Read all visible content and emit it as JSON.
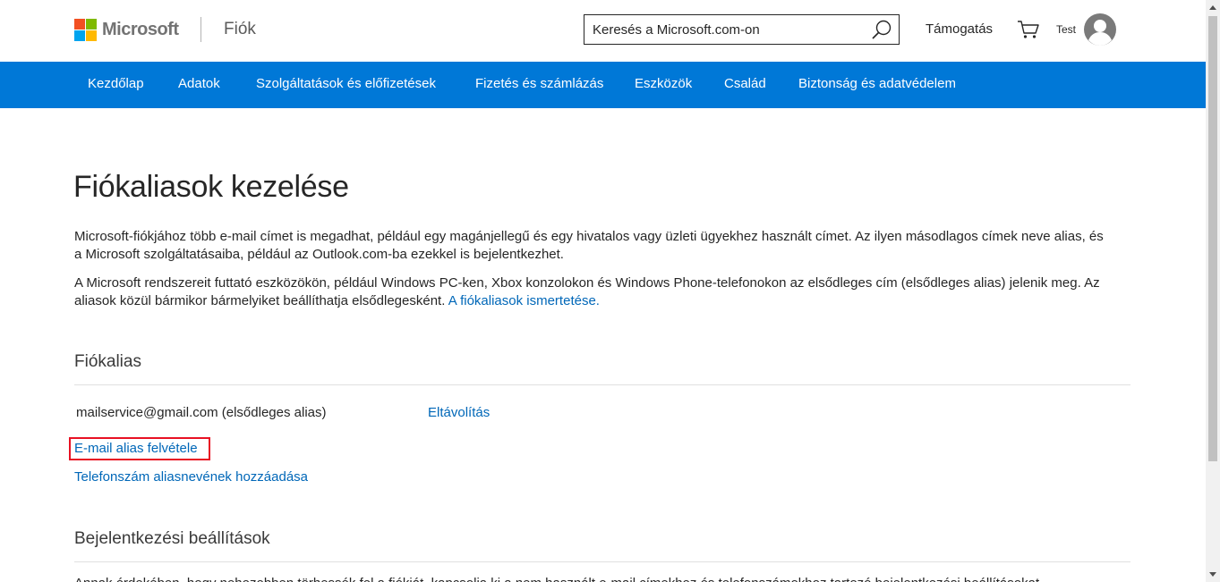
{
  "header": {
    "logo_text": "Microsoft",
    "section": "Fiók",
    "search_placeholder": "Keresés a Microsoft.com-on",
    "support_label": "Támogatás",
    "user_name": "Test"
  },
  "nav": {
    "items": [
      {
        "label": "Kezdőlap"
      },
      {
        "label": "Adatok"
      },
      {
        "label": "Szolgáltatások és előfizetések"
      },
      {
        "label": "Fizetés és számlázás"
      },
      {
        "label": "Eszközök"
      },
      {
        "label": "Család"
      },
      {
        "label": "Biztonság és adatvédelem"
      }
    ]
  },
  "main": {
    "title": "Fiókaliasok kezelése",
    "paragraph1": "Microsoft-fiókjához több e-mail címet is megadhat, például egy magánjellegű és egy hivatalos vagy üzleti ügyekhez használt címet. Az ilyen másodlagos címek neve alias, és a Microsoft szolgáltatásaiba, például az Outlook.com-ba ezekkel is bejelentkezhet.",
    "paragraph2": "A Microsoft rendszereit futtató eszközökön, például Windows PC-ken, Xbox konzolokon és Windows Phone-telefonokon az elsődleges cím (elsődleges alias) jelenik meg. Az aliasok közül bármikor bármelyiket beállíthatja elsődlegesként.",
    "paragraph2_link": "A fiókaliasok ismertetése.",
    "alias_section_title": "Fiókalias",
    "alias_email": "mailservice@gmail.com (elsődleges alias)",
    "remove_label": "Eltávolítás",
    "add_email_alias": "E-mail alias felvétele",
    "add_phone_alias": "Telefonszám aliasnevének hozzáadása",
    "signin_section_title": "Bejelentkezési beállítások",
    "signin_text_cut": "Annak érdekében, hogy nehezebben törhessék fel a fiókját, kapcsolja ki a nem használt e-mail címekhez és telefonszámokhoz tartozó bejelentkezési beállításokat."
  },
  "colors": {
    "nav_bg": "#0078d7",
    "link": "#0067b8",
    "highlight": "#e81123"
  }
}
